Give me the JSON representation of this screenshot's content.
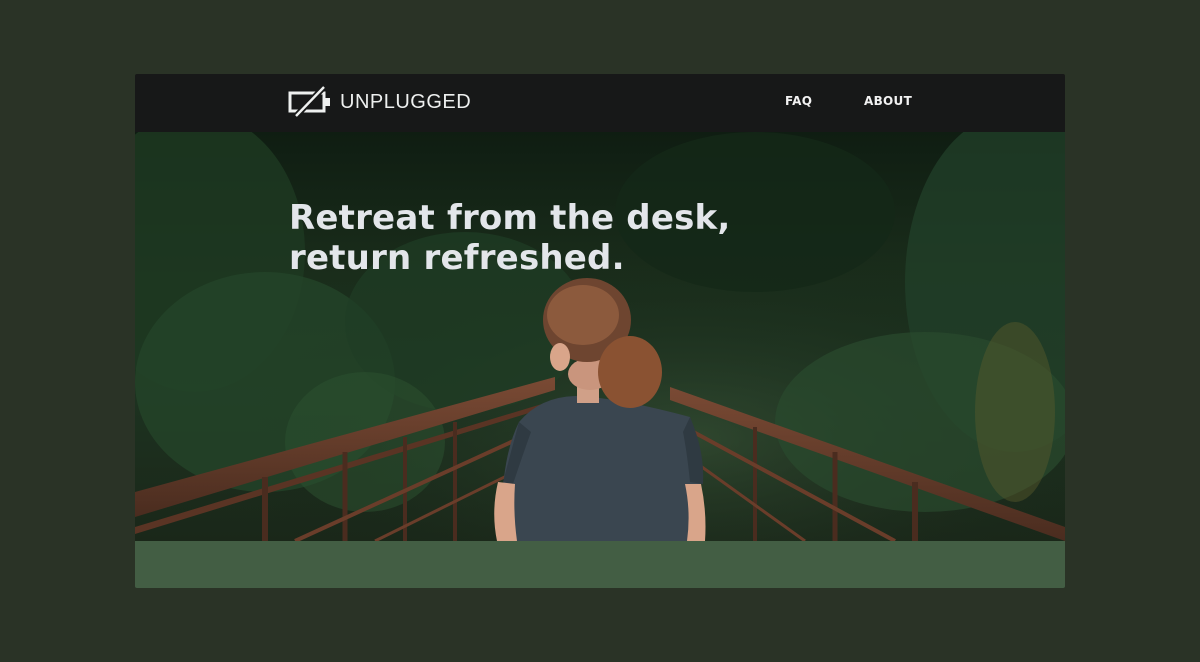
{
  "brand": {
    "name": "UNPLUGGED",
    "icon": "unplugged-battery-icon"
  },
  "nav": {
    "faq": "FAQ",
    "about": "ABOUT"
  },
  "hero": {
    "title_line1": "Retreat from the desk,",
    "title_line2": "return refreshed.",
    "image": "woman-on-forest-bridge-photo"
  },
  "colors": {
    "page_background": "#2a3326",
    "navbar": "#171818",
    "footer_band": "#435e44",
    "text": "#e3e6ea"
  }
}
